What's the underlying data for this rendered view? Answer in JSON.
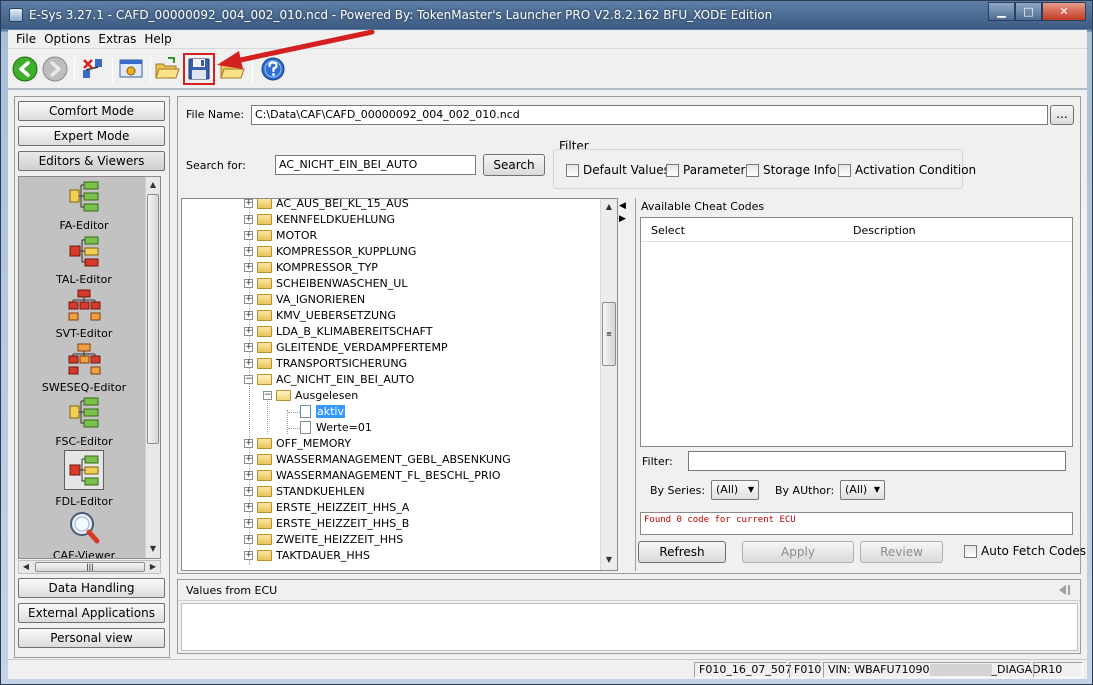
{
  "window": {
    "title": "E-Sys 3.27.1 - CAFD_00000092_004_002_010.ncd - Powered By: TokenMaster's Launcher PRO V2.8.2.162 BFU_XODE Edition",
    "minimize": "▁",
    "maximize": "□",
    "close": "✕"
  },
  "menu": [
    "File",
    "Options",
    "Extras",
    "Help"
  ],
  "toolbar": {
    "icons": [
      "back-arrow-icon",
      "forward-arrow-icon",
      "connect-icon",
      "vehicle-order-icon",
      "open-folder-icon",
      "save-disk-icon",
      "open-folder-arrow-icon",
      "help-icon"
    ]
  },
  "sidebar": {
    "top_buttons": [
      "Comfort Mode",
      "Expert Mode",
      "Editors & Viewers"
    ],
    "editors": [
      "FA-Editor",
      "TAL-Editor",
      "SVT-Editor",
      "SWESEQ-Editor",
      "FSC-Editor",
      "FDL-Editor",
      "CAF-Viewer"
    ],
    "selected_editor": "FDL-Editor",
    "bottom_buttons": [
      "Data Handling",
      "External Applications",
      "Personal view"
    ]
  },
  "file": {
    "label": "File Name:",
    "value": "C:\\Data\\CAF\\CAFD_00000092_004_002_010.ncd",
    "browse": "..."
  },
  "search": {
    "label": "Search for:",
    "value": "AC_NICHT_EIN_BEI_AUTO",
    "button": "Search"
  },
  "filter": {
    "title": "Filter",
    "options": [
      "Default Values",
      "Parameter",
      "Storage Info",
      "Activation Condition"
    ]
  },
  "tree": {
    "items": [
      "AC_AUS_BEI_KL_15_AUS",
      "KENNFELDKUEHLUNG",
      "MOTOR",
      "KOMPRESSOR_KUPPLUNG",
      "KOMPRESSOR_TYP",
      "SCHEIBENWASCHEN_UL",
      "VA_IGNORIEREN",
      "KMV_UEBERSETZUNG",
      "LDA_B_KLIMABEREITSCHAFT",
      "GLEITENDE_VERDAMPFERTEMP",
      "TRANSPORTSICHERUNG",
      "AC_NICHT_EIN_BEI_AUTO",
      "Ausgelesen",
      "aktiv",
      "Werte=01",
      "OFF_MEMORY",
      "WASSERMANAGEMENT_GEBL_ABSENKUNG",
      "WASSERMANAGEMENT_FL_BESCHL_PRIO",
      "STANDKUEHLEN",
      "ERSTE_HEIZZEIT_HHS_A",
      "ERSTE_HEIZZEIT_HHS_B",
      "ZWEITE_HEIZZEIT_HHS",
      "TAKTDAUER_HHS"
    ]
  },
  "cheat": {
    "title": "Available Cheat Codes",
    "col_select": "Select",
    "col_description": "Description",
    "filter_label": "Filter:",
    "filter_value": "",
    "series_label": "By Series:",
    "series_value": "(All)",
    "author_label": "By AUthor:",
    "author_value": "(All)",
    "message": "Found 0 code for current ECU",
    "refresh": "Refresh",
    "apply": "Apply",
    "review": "Review",
    "auto_fetch": "Auto Fetch Codes"
  },
  "ecu": {
    "title": "Values from ECU"
  },
  "status": {
    "file": "F010_16_07_507",
    "series": "F010",
    "vin_prefix": "VIN: WBAFU71090",
    "vin_suffix": "_DIAGADR10"
  },
  "colors": {
    "accent_red": "#d42020",
    "selection": "#3399ff",
    "message_red": "#c00000"
  }
}
